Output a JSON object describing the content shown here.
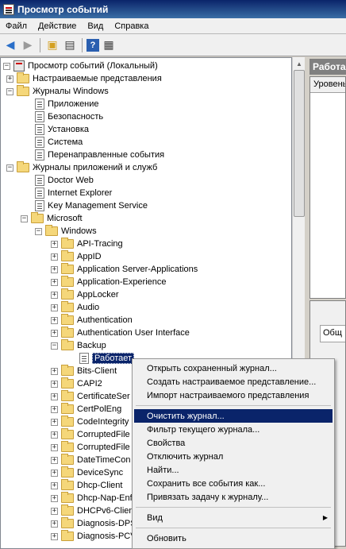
{
  "window": {
    "title": "Просмотр событий"
  },
  "menu": [
    "Файл",
    "Действие",
    "Вид",
    "Справка"
  ],
  "toolbar": {
    "icons": [
      "back-icon",
      "forward-icon",
      "up-folder-icon",
      "show-hide-tree-icon",
      "help-icon",
      "properties-icon"
    ]
  },
  "tree": {
    "root": "Просмотр событий (Локальный)",
    "custom_views": "Настраиваемые представления",
    "windows_logs": "Журналы Windows",
    "windows_logs_items": [
      "Приложение",
      "Безопасность",
      "Установка",
      "Система",
      "Перенаправленные события"
    ],
    "app_logs": "Журналы приложений и служб",
    "app_logs_items": [
      "Doctor Web",
      "Internet Explorer",
      "Key Management Service"
    ],
    "microsoft": "Microsoft",
    "windows": "Windows",
    "windows_items_before": [
      "API-Tracing",
      "AppID",
      "Application Server-Applications",
      "Application-Experience",
      "AppLocker",
      "Audio",
      "Authentication",
      "Authentication User Interface",
      "Backup"
    ],
    "backup_child": "Работает",
    "windows_items_after": [
      "Bits-Client",
      "CAPI2",
      "CertificateSer",
      "CertPolEng",
      "CodeIntegrity",
      "CorruptedFile",
      "CorruptedFile",
      "DateTimeCon",
      "DeviceSync",
      "Dhcp-Client",
      "Dhcp-Nap-Enf",
      "DHCPv6-Clien",
      "Diagnosis-DPS",
      "Diagnosis-PCV"
    ]
  },
  "right": {
    "header": "Работа",
    "column": "Уровень",
    "tab": "Общ"
  },
  "context_menu": {
    "group1": [
      "Открыть сохраненный журнал...",
      "Создать настраиваемое представление...",
      "Импорт настраиваемого представления"
    ],
    "group2": [
      "Очистить журнал...",
      "Фильтр текущего журнала...",
      "Свойства",
      "Отключить журнал",
      "Найти...",
      "Сохранить все события как...",
      "Привязать задачу к журналу..."
    ],
    "view": "Вид",
    "refresh": "Обновить",
    "highlighted": "Очистить журнал..."
  }
}
